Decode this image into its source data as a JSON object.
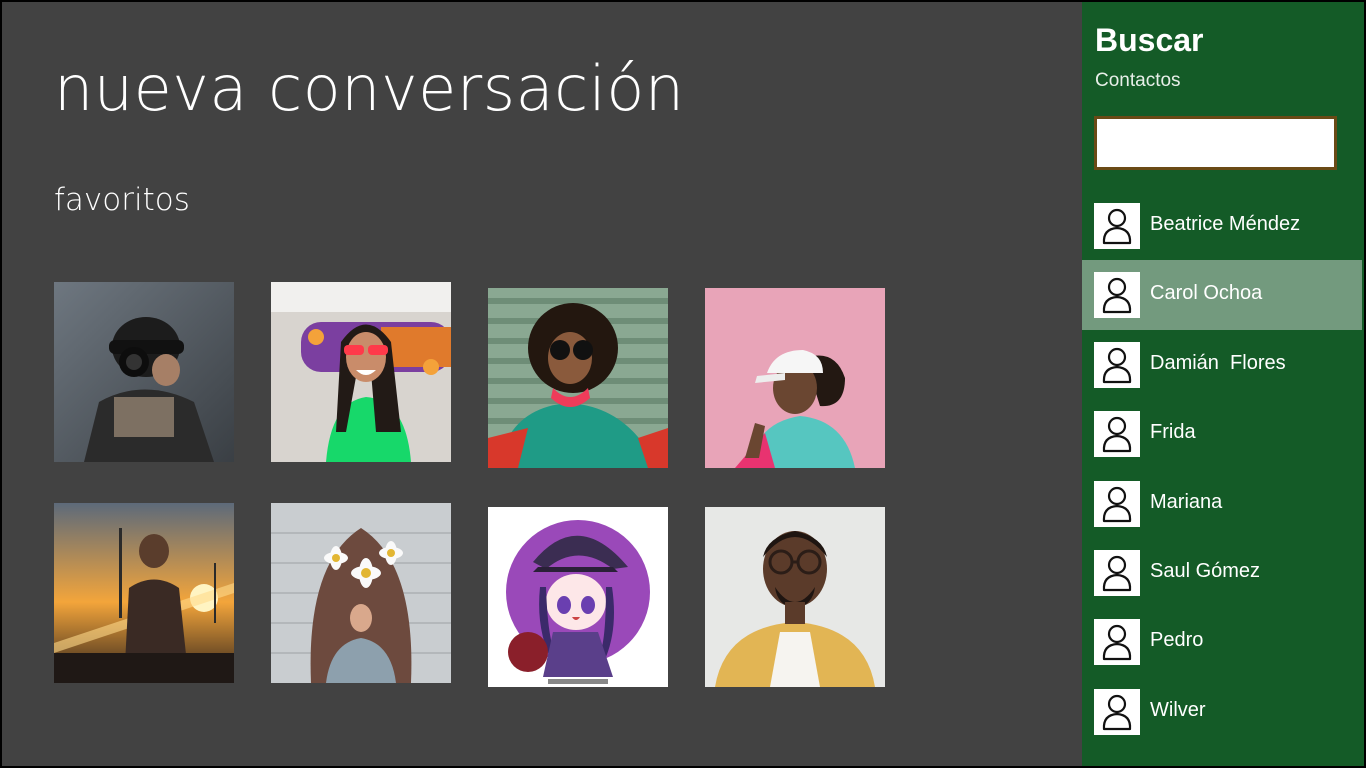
{
  "header": {
    "title": "nueva conversación"
  },
  "favorites": {
    "title": "favoritos",
    "items": [
      {
        "icon": "photo-man-camera"
      },
      {
        "icon": "photo-woman-skateboard"
      },
      {
        "icon": "photo-woman-sunglasses"
      },
      {
        "icon": "photo-woman-cap-pink"
      },
      {
        "icon": "photo-man-sunset"
      },
      {
        "icon": "photo-woman-flowers"
      },
      {
        "icon": "photo-anime-character"
      },
      {
        "icon": "photo-man-glasses"
      }
    ]
  },
  "panel": {
    "title": "Buscar",
    "subtitle": "Contactos",
    "search_value": "",
    "contacts": [
      {
        "name": "Beatrice Méndez",
        "selected": false
      },
      {
        "name": "Carol Ochoa",
        "selected": true
      },
      {
        "name": "Damián  Flores",
        "selected": false
      },
      {
        "name": "Frida",
        "selected": false
      },
      {
        "name": "Mariana",
        "selected": false
      },
      {
        "name": "Saul Gómez",
        "selected": false
      },
      {
        "name": "Pedro",
        "selected": false
      },
      {
        "name": "Wilver",
        "selected": false
      }
    ]
  },
  "colors": {
    "background": "#424242",
    "panel": "#145b27",
    "selected_row": "#739a7e",
    "search_border": "#6a4a16"
  }
}
